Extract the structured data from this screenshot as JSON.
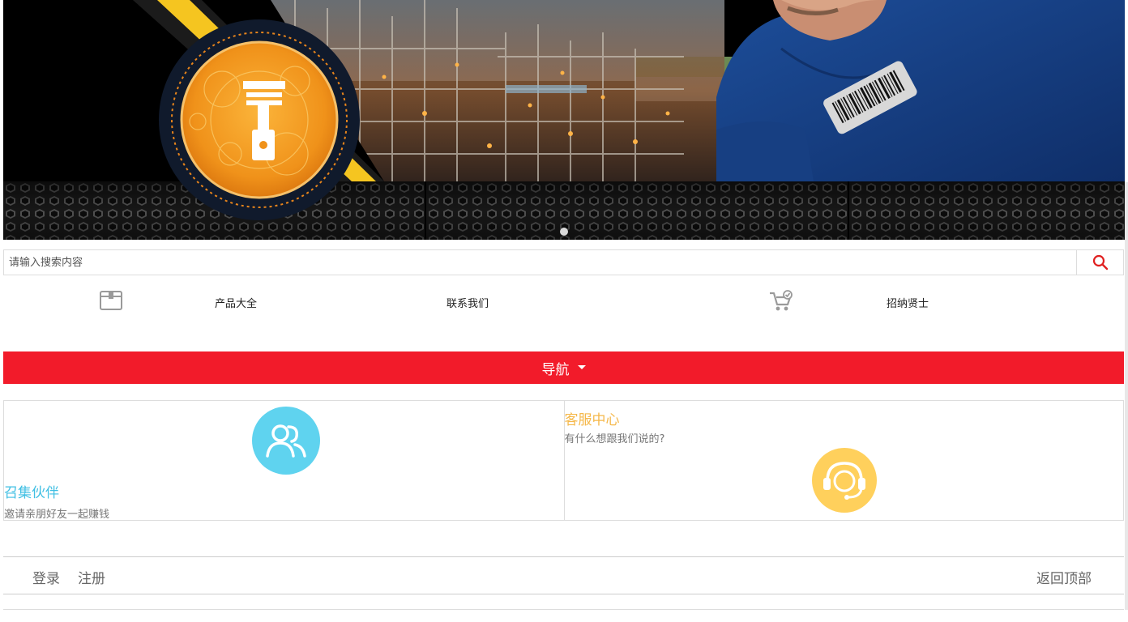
{
  "banner": {
    "slide_count": 1,
    "active_slide": 1
  },
  "search": {
    "placeholder": "请输入搜索内容",
    "value": "",
    "icon": "search-icon",
    "accent": "#e02020"
  },
  "quick_links": [
    {
      "label": "产品大全",
      "icon": "box-icon"
    },
    {
      "label": "联系我们",
      "icon": ""
    },
    {
      "label": "招纳贤士",
      "icon": "cart-check-icon"
    }
  ],
  "nav": {
    "label": "导航",
    "color": "#f21b2a",
    "icon": "caret-down-icon"
  },
  "cards": [
    {
      "title": "召集伙伴",
      "subtitle": "邀请亲朋好友一起赚钱",
      "icon": "users-icon",
      "color": "#5fd3ef"
    },
    {
      "title": "客服中心",
      "subtitle": "有什么想跟我们说的?",
      "icon": "headset-icon",
      "color": "#ffd05c",
      "title_color": "#f5b84a"
    }
  ],
  "footer": {
    "login": "登录",
    "register": "注册",
    "back_to_top": "返回顶部"
  }
}
